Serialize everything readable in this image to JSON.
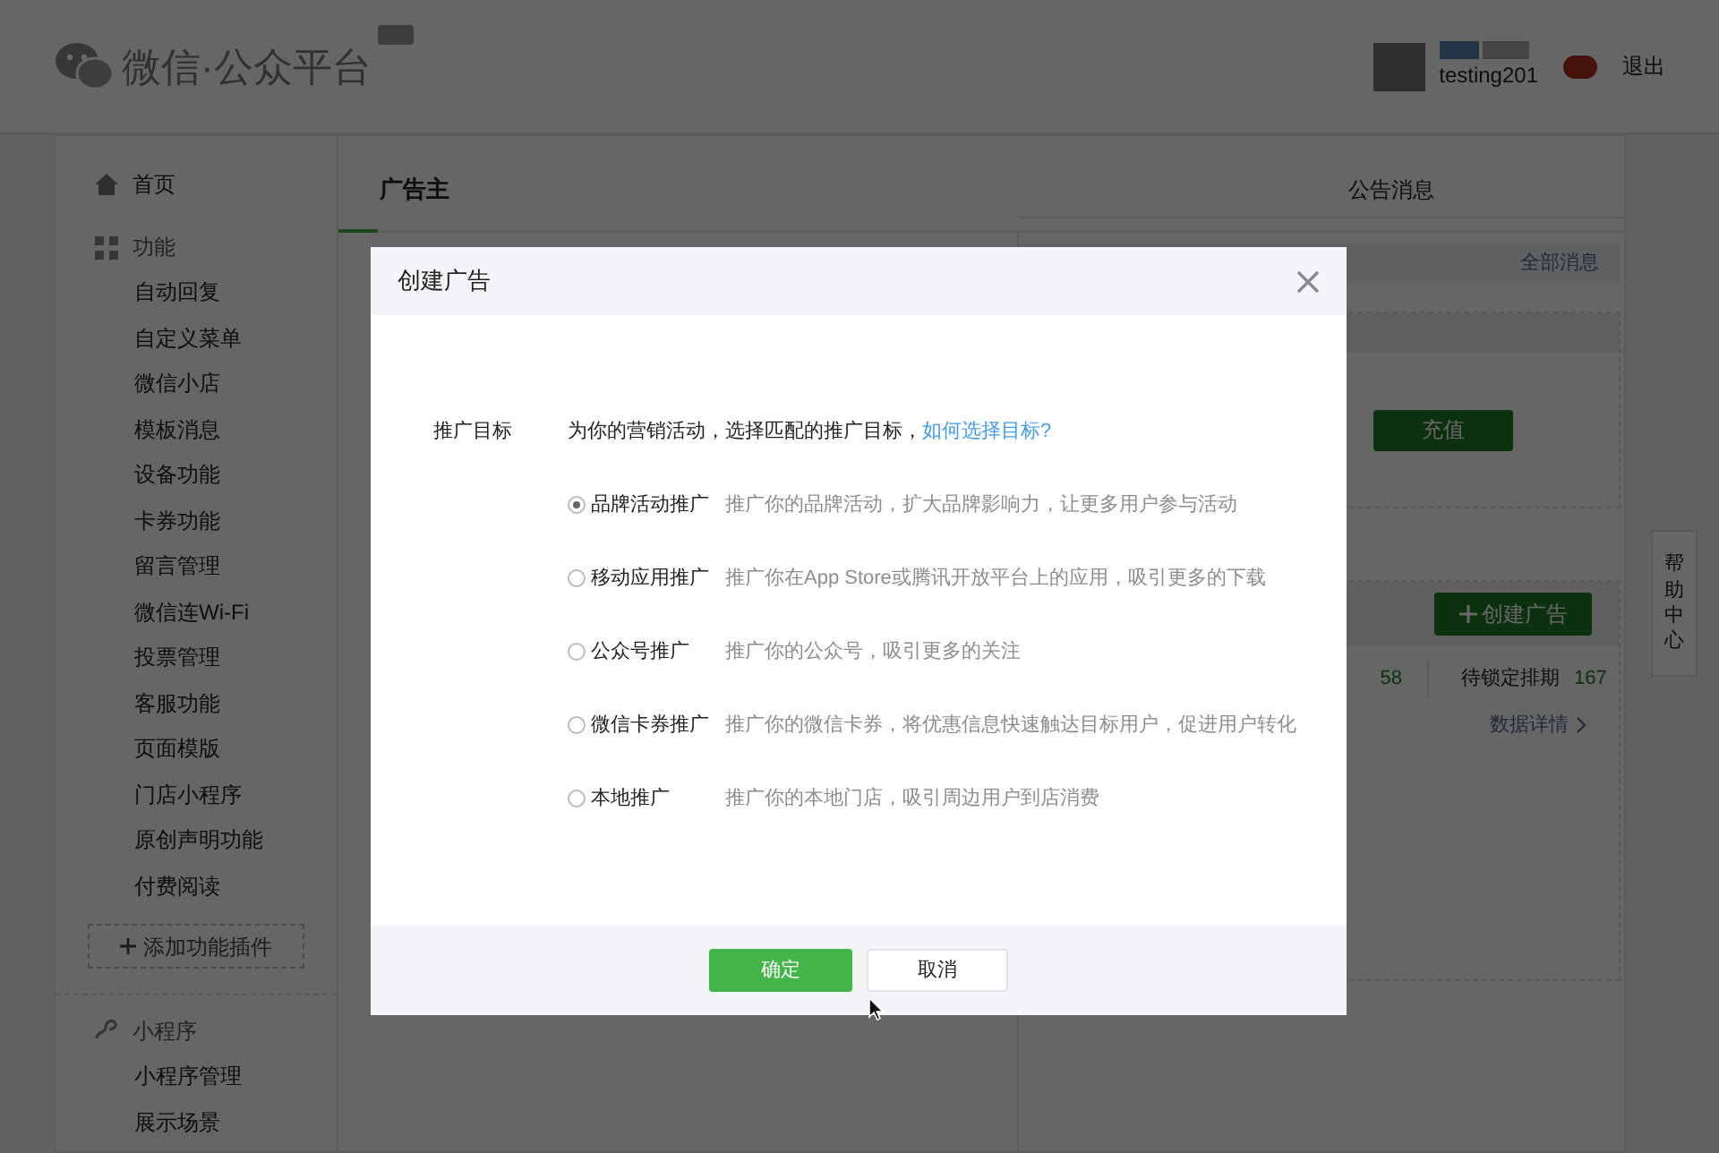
{
  "header": {
    "logo_text": "微信·公众平台",
    "username": "testing201",
    "logout": "退出"
  },
  "sidebar": {
    "home": "首页",
    "sections": [
      {
        "title": "功能",
        "kind": "grid",
        "items": [
          "自动回复",
          "自定义菜单",
          "微信小店",
          "模板消息",
          "设备功能",
          "卡券功能",
          "留言管理",
          "微信连Wi-Fi",
          "投票管理",
          "客服功能",
          "页面模版",
          "门店小程序",
          "原创声明功能",
          "付费阅读"
        ],
        "add_button": "添加功能插件"
      },
      {
        "title": "小程序",
        "kind": "miniprogram",
        "items": [
          "小程序管理",
          "展示场景"
        ]
      }
    ]
  },
  "main": {
    "title": "广告主",
    "panel": {
      "tab": "公告消息",
      "all_messages": "全部消息",
      "recharge": "充值",
      "create_ad": "创建广告",
      "stats": [
        {
          "value": "58"
        },
        {
          "label": "待锁定排期",
          "value": "167"
        }
      ],
      "data_details": "数据详情"
    }
  },
  "help_tab": "帮助中心",
  "modal": {
    "title": "创建广告",
    "field_label": "推广目标",
    "intro": "为你的营销活动，选择匹配的推广目标，",
    "intro_link": "如何选择目标?",
    "options": [
      {
        "label": "品牌活动推广",
        "description": "推广你的品牌活动，扩大品牌影响力，让更多用户参与活动",
        "selected": true
      },
      {
        "label": "移动应用推广",
        "description": "推广你在App Store或腾讯开放平台上的应用，吸引更多的下载",
        "selected": false
      },
      {
        "label": "公众号推广",
        "description": "推广你的公众号，吸引更多的关注",
        "selected": false
      },
      {
        "label": "微信卡券推广",
        "description": "推广你的微信卡券，将优惠信息快速触达目标用户，促进用户转化",
        "selected": false
      },
      {
        "label": "本地推广",
        "description": "推广你的本地门店，吸引周边用户到店消费",
        "selected": false
      }
    ],
    "confirm": "确定",
    "cancel": "取消"
  }
}
